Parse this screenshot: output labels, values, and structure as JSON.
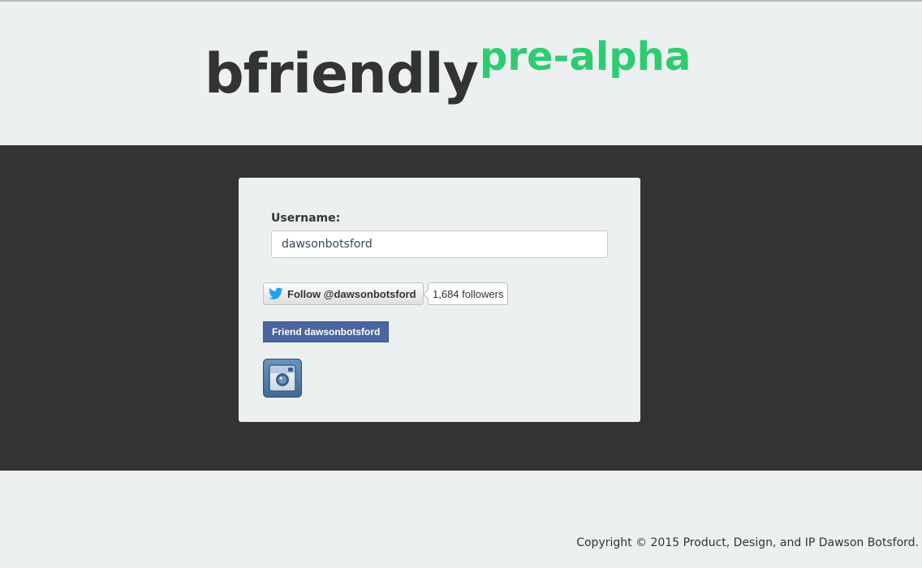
{
  "header": {
    "brand_name": "bfriendly",
    "brand_tag": "pre-alpha"
  },
  "form": {
    "username_label": "Username:",
    "username_value": "dawsonbotsford"
  },
  "social": {
    "twitter_follow_label": "Follow @dawsonbotsford",
    "twitter_followers": "1,684 followers",
    "facebook_friend_label": "Friend dawsonbotsford",
    "instagram_icon": "instagram-icon"
  },
  "footer": {
    "copyright": "Copyright © 2015 Product, Design, and IP Dawson Botsford."
  },
  "colors": {
    "background": "#ecf0f1",
    "band": "#333333",
    "accent": "#2ecc71",
    "brand_text": "#333333",
    "facebook": "#4a66a0",
    "twitter": "#1da1f2"
  }
}
